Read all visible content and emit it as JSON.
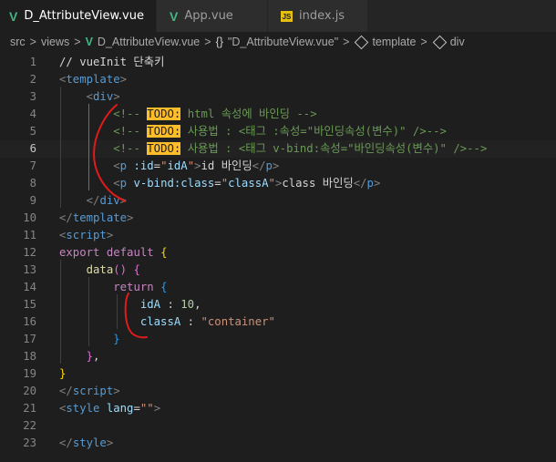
{
  "tabs": [
    {
      "label": "D_AttributeView.vue",
      "icon": "vue-icon",
      "active": true,
      "modified": true
    },
    {
      "label": "App.vue",
      "icon": "vue-icon",
      "active": false
    },
    {
      "label": "index.js",
      "icon": "js-icon",
      "active": false
    }
  ],
  "icon_text": {
    "vue": "V",
    "js": "JS"
  },
  "breadcrumb": {
    "src": "src",
    "views": "views",
    "file": "D_AttributeView.vue",
    "component_bracket": "{}",
    "component": "\"D_AttributeView.vue\"",
    "template": "template",
    "div": "div",
    "separator": ">"
  },
  "editor": {
    "current_line": 6,
    "lines": [
      {
        "n": "1",
        "tokens": [
          [
            "c-text",
            "// vueInit 단축키"
          ]
        ]
      },
      {
        "n": "2",
        "tokens": [
          [
            "c-bracket",
            "<"
          ],
          [
            "c-tag",
            "template"
          ],
          [
            "c-bracket",
            ">"
          ]
        ]
      },
      {
        "n": "3",
        "tokens": [
          [
            "c-text",
            "    "
          ],
          [
            "c-bracket",
            "<"
          ],
          [
            "c-tag",
            "div"
          ],
          [
            "c-bracket",
            ">"
          ]
        ]
      },
      {
        "n": "4",
        "tokens": [
          [
            "c-text",
            "        "
          ],
          [
            "c-comment",
            "<!-- "
          ],
          [
            "todo",
            "TODO:"
          ],
          [
            "c-comment",
            " html 속성에 바인딩 -->"
          ]
        ]
      },
      {
        "n": "5",
        "tokens": [
          [
            "c-text",
            "        "
          ],
          [
            "c-comment",
            "<!-- "
          ],
          [
            "todo",
            "TODO:"
          ],
          [
            "c-comment",
            " 사용법 : <태그 :속성=\"바인딩속성(변수)\" />-->"
          ]
        ]
      },
      {
        "n": "6",
        "tokens": [
          [
            "c-text",
            "        "
          ],
          [
            "c-comment",
            "<!-- "
          ],
          [
            "todo",
            "TODO:"
          ],
          [
            "c-comment",
            " 사용법 : <태그 v-bind:속성=\"바인딩속성(변수)\" />-->"
          ]
        ]
      },
      {
        "n": "7",
        "tokens": [
          [
            "c-text",
            "        "
          ],
          [
            "c-bracket",
            "<"
          ],
          [
            "c-tag",
            "p"
          ],
          [
            "c-text",
            " "
          ],
          [
            "c-attr",
            ":id"
          ],
          [
            "c-text",
            "="
          ],
          [
            "c-str",
            "\""
          ],
          [
            "c-attr",
            "idA"
          ],
          [
            "c-str",
            "\""
          ],
          [
            "c-bracket",
            ">"
          ],
          [
            "c-text",
            "id 바인딩"
          ],
          [
            "c-bracket",
            "</"
          ],
          [
            "c-tag",
            "p"
          ],
          [
            "c-bracket",
            ">"
          ]
        ]
      },
      {
        "n": "8",
        "tokens": [
          [
            "c-text",
            "        "
          ],
          [
            "c-bracket",
            "<"
          ],
          [
            "c-tag",
            "p"
          ],
          [
            "c-text",
            " "
          ],
          [
            "c-attr",
            "v-bind:class"
          ],
          [
            "c-text",
            "="
          ],
          [
            "c-str",
            "\""
          ],
          [
            "c-attr",
            "classA"
          ],
          [
            "c-str",
            "\""
          ],
          [
            "c-bracket",
            ">"
          ],
          [
            "c-text",
            "class 바인딩"
          ],
          [
            "c-bracket",
            "</"
          ],
          [
            "c-tag",
            "p"
          ],
          [
            "c-bracket",
            ">"
          ]
        ]
      },
      {
        "n": "9",
        "tokens": [
          [
            "c-text",
            "    "
          ],
          [
            "c-bracket",
            "</"
          ],
          [
            "c-tag",
            "div"
          ],
          [
            "c-bracket",
            ">"
          ]
        ]
      },
      {
        "n": "10",
        "tokens": [
          [
            "c-bracket",
            "</"
          ],
          [
            "c-tag",
            "template"
          ],
          [
            "c-bracket",
            ">"
          ]
        ]
      },
      {
        "n": "11",
        "tokens": [
          [
            "c-bracket",
            "<"
          ],
          [
            "c-tag",
            "script"
          ],
          [
            "c-bracket",
            ">"
          ]
        ]
      },
      {
        "n": "12",
        "tokens": [
          [
            "c-kw",
            "export"
          ],
          [
            "c-text",
            " "
          ],
          [
            "c-kw",
            "default"
          ],
          [
            "c-text",
            " "
          ],
          [
            "c-brace1",
            "{"
          ]
        ]
      },
      {
        "n": "13",
        "tokens": [
          [
            "c-text",
            "    "
          ],
          [
            "c-fn",
            "data"
          ],
          [
            "c-brace2",
            "()"
          ],
          [
            "c-text",
            " "
          ],
          [
            "c-brace2",
            "{"
          ]
        ]
      },
      {
        "n": "14",
        "tokens": [
          [
            "c-text",
            "        "
          ],
          [
            "c-kw",
            "return"
          ],
          [
            "c-text",
            " "
          ],
          [
            "c-brace3",
            "{"
          ]
        ]
      },
      {
        "n": "15",
        "tokens": [
          [
            "c-text",
            "            "
          ],
          [
            "c-attr",
            "idA"
          ],
          [
            "c-text",
            " : "
          ],
          [
            "c-num",
            "10"
          ],
          [
            "c-text",
            ","
          ]
        ]
      },
      {
        "n": "16",
        "tokens": [
          [
            "c-text",
            "            "
          ],
          [
            "c-attr",
            "classA"
          ],
          [
            "c-text",
            " : "
          ],
          [
            "c-str",
            "\"container\""
          ]
        ]
      },
      {
        "n": "17",
        "tokens": [
          [
            "c-text",
            "        "
          ],
          [
            "c-brace3",
            "}"
          ]
        ]
      },
      {
        "n": "18",
        "tokens": [
          [
            "c-text",
            "    "
          ],
          [
            "c-brace2",
            "}"
          ],
          [
            "c-text",
            ","
          ]
        ]
      },
      {
        "n": "19",
        "tokens": [
          [
            "c-brace1",
            "}"
          ]
        ]
      },
      {
        "n": "20",
        "tokens": [
          [
            "c-bracket",
            "</"
          ],
          [
            "c-tag",
            "script"
          ],
          [
            "c-bracket",
            ">"
          ]
        ]
      },
      {
        "n": "21",
        "tokens": [
          [
            "c-bracket",
            "<"
          ],
          [
            "c-tag",
            "style"
          ],
          [
            "c-text",
            " "
          ],
          [
            "c-attr",
            "lang"
          ],
          [
            "c-text",
            "="
          ],
          [
            "c-str",
            "\"\""
          ],
          [
            "c-bracket",
            ">"
          ]
        ]
      },
      {
        "n": "22",
        "tokens": []
      },
      {
        "n": "23",
        "tokens": [
          [
            "c-bracket",
            "</"
          ],
          [
            "c-tag",
            "style"
          ],
          [
            "c-bracket",
            ">"
          ]
        ]
      }
    ]
  },
  "colors": {
    "editor_bg": "#1e1e1e",
    "tab_bar_bg": "#252526",
    "todo_highlight": "#ffbd2a",
    "annotation_red": "#e01b1b",
    "vue_green": "#41b883"
  }
}
